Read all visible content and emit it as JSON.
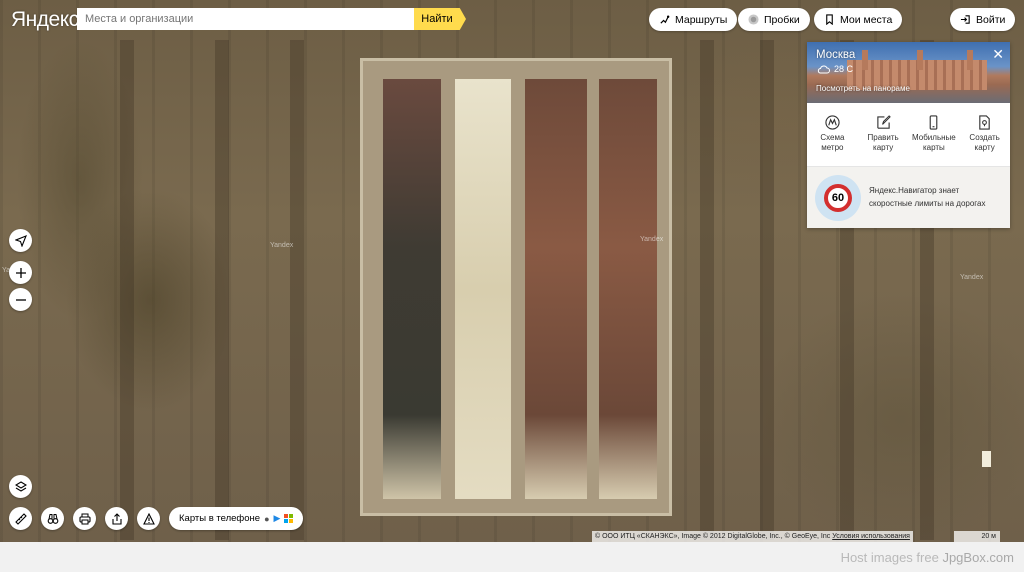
{
  "header": {
    "logo": "Яндекс",
    "search_placeholder": "Места и организации",
    "search_button": "Найти",
    "routes": "Маршруты",
    "traffic": "Пробки",
    "my_places": "Мои места",
    "login": "Войти"
  },
  "card": {
    "city": "Москва",
    "temperature": "28 С",
    "panorama_link": "Посмотреть на панораме",
    "tiles": [
      {
        "label1": "Схема",
        "label2": "метро",
        "icon": "metro-icon"
      },
      {
        "label1": "Править",
        "label2": "карту",
        "icon": "edit-icon"
      },
      {
        "label1": "Мобильные",
        "label2": "карты",
        "icon": "mobile-icon"
      },
      {
        "label1": "Создать",
        "label2": "карту",
        "icon": "create-map-icon"
      }
    ],
    "promo_sign": "60",
    "promo_line1": "Яндекс.Навигатор знает",
    "promo_line2": "скоростные лимиты на дорогах"
  },
  "map": {
    "watermark": "Yandex",
    "copyright": "© ООО ИТЦ «СКАНЭКС», Image © 2012 DigitalGlobe, Inc., © GeoEye, Inc",
    "terms": "Условия использования",
    "scale": "20 м"
  },
  "phone_pill": "Карты в телефоне",
  "footer": {
    "host": "Host images free",
    "brand": "JpgBox.com"
  }
}
